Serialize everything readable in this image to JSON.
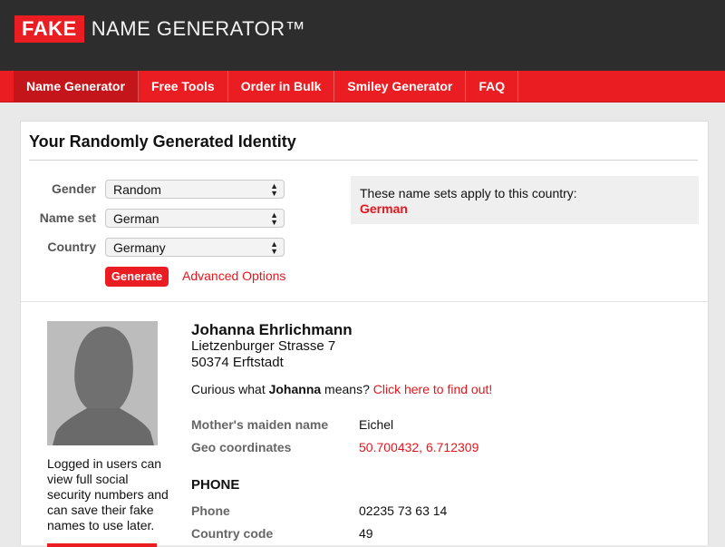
{
  "header": {
    "logo_fake": "FAKE",
    "logo_rest": "NAME GENERATOR™"
  },
  "nav": {
    "items": [
      {
        "label": "Name Generator",
        "active": true
      },
      {
        "label": "Free Tools",
        "active": false
      },
      {
        "label": "Order in Bulk",
        "active": false
      },
      {
        "label": "Smiley Generator",
        "active": false
      },
      {
        "label": "FAQ",
        "active": false
      }
    ]
  },
  "page": {
    "title": "Your Randomly Generated Identity"
  },
  "form": {
    "gender_label": "Gender",
    "gender_value": "Random",
    "nameset_label": "Name set",
    "nameset_value": "German",
    "country_label": "Country",
    "country_value": "Germany",
    "generate_label": "Generate",
    "advanced_label": "Advanced Options"
  },
  "info": {
    "text": "These name sets apply to this country:",
    "country": "German"
  },
  "identity": {
    "avatar_note": "Logged in users can view full social security numbers and can save their fake names to use later.",
    "name": "Johanna Ehrlichmann",
    "street": "Lietzenburger Strasse 7",
    "city": "50374 Erftstadt",
    "curious_prefix": "Curious what ",
    "first_name": "Johanna",
    "curious_mid": " means? ",
    "curious_link": "Click here to find out!",
    "maiden_label": "Mother's maiden name",
    "maiden_value": "Eichel",
    "geo_label": "Geo coordinates",
    "geo_value": "50.700432, 6.712309",
    "phone_section": "PHONE",
    "phone_label": "Phone",
    "phone_value": "02235 73 63 14",
    "country_code_label": "Country code",
    "country_code_value": "49"
  },
  "colors": {
    "brand_red": "#ea1d23",
    "header_dark": "#2d2d2d"
  }
}
